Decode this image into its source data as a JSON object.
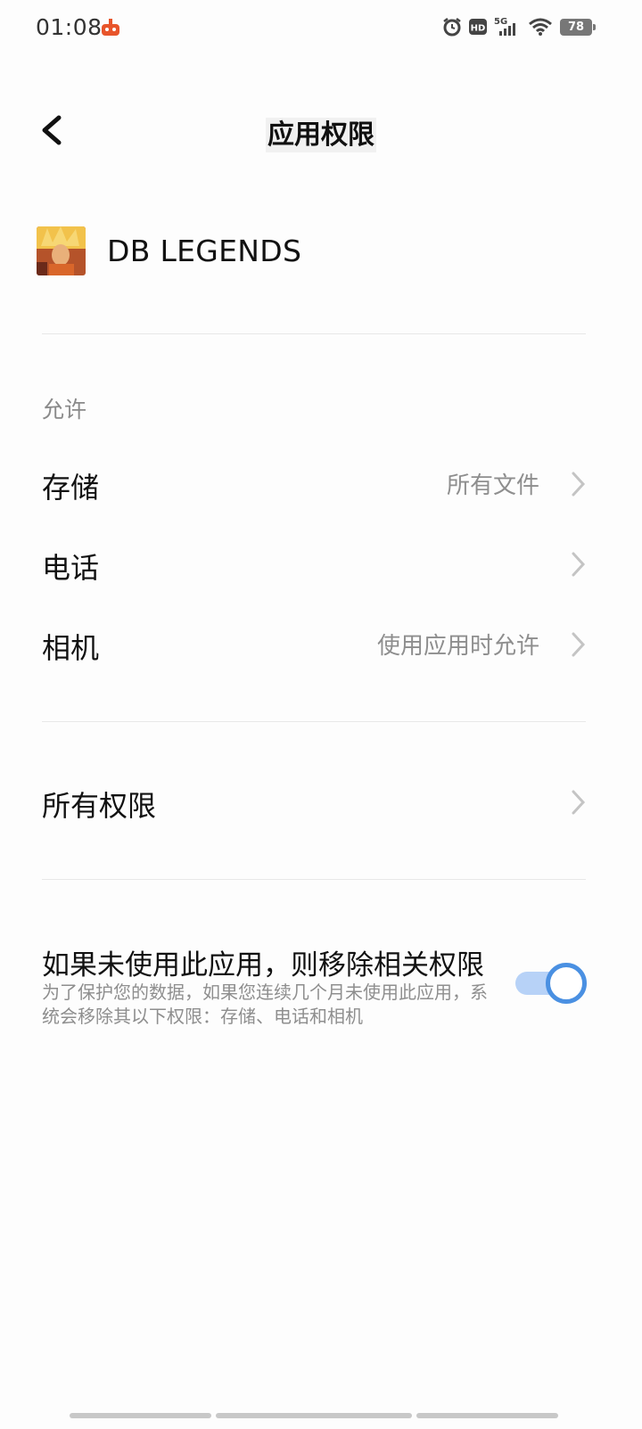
{
  "status_bar": {
    "time": "01:08",
    "battery": "78",
    "network": "5G",
    "hd_badge": "HD",
    "icons": [
      "notification-icon",
      "alarm-icon",
      "hd-icon",
      "signal-icon",
      "wifi-icon",
      "battery-icon"
    ]
  },
  "header": {
    "title": "应用权限",
    "back_icon": "chevron-left-icon"
  },
  "app": {
    "name": "DB LEGENDS"
  },
  "permissions": {
    "section_label": "允许",
    "items": [
      {
        "label": "存储",
        "value": "所有文件"
      },
      {
        "label": "电话",
        "value": ""
      },
      {
        "label": "相机",
        "value": "使用应用时允许"
      }
    ]
  },
  "all_permissions": {
    "label": "所有权限"
  },
  "auto_revoke": {
    "title": "如果未使用此应用，则移除相关权限",
    "description": "为了保护您的数据，如果您连续几个月未使用此应用，系统会移除其以下权限：存储、电话和相机",
    "enabled": true
  },
  "colors": {
    "accent": "#4a90e2",
    "toggle_track": "#b7d2f7",
    "secondary_text": "#8e8e8e"
  }
}
